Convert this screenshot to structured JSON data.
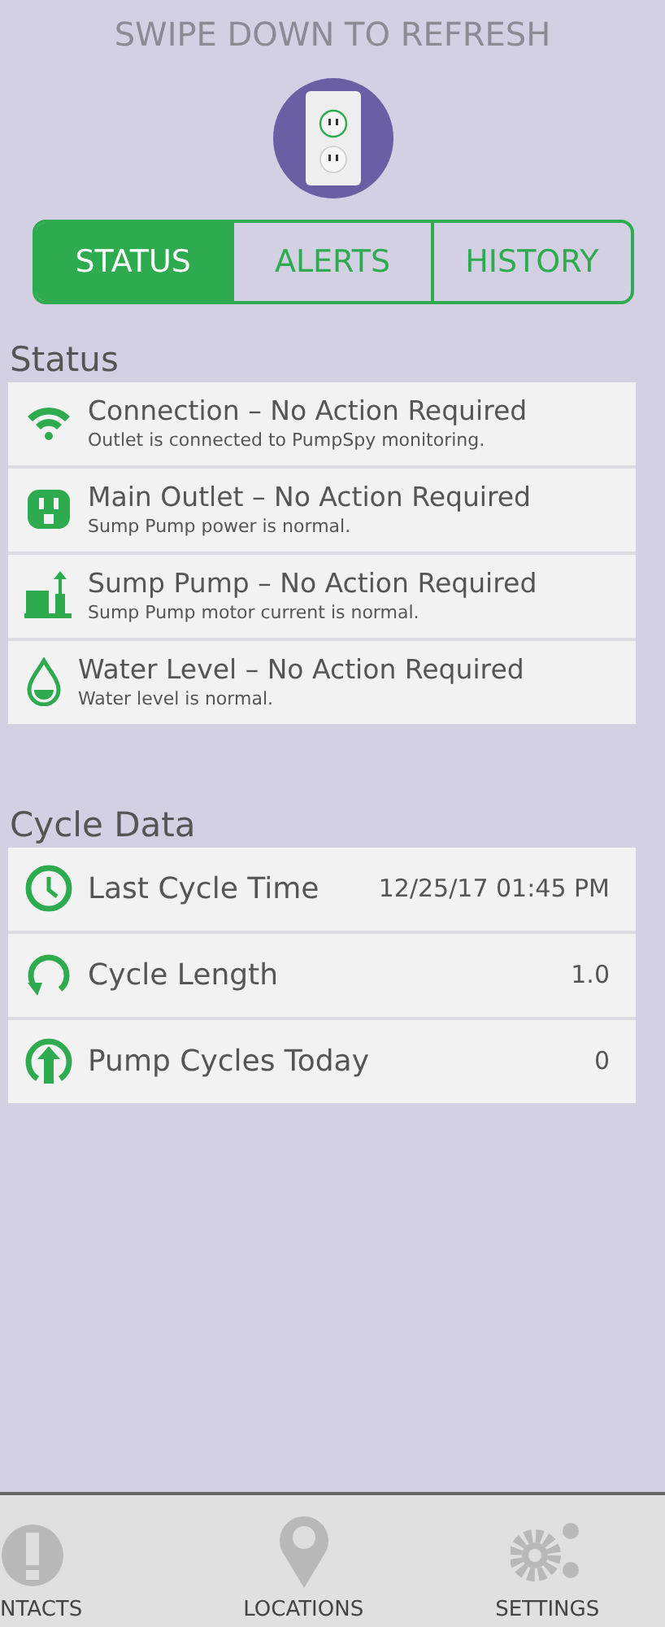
{
  "header": {
    "hint": "SWIPE DOWN TO REFRESH"
  },
  "tabs": [
    {
      "label": "STATUS",
      "selected": true
    },
    {
      "label": "ALERTS",
      "selected": false
    },
    {
      "label": "HISTORY",
      "selected": false
    }
  ],
  "status": {
    "heading": "Status",
    "items": [
      {
        "kind": "wifi",
        "title": "Connection – No Action Required",
        "detail": "Outlet is connected to PumpSpy monitoring."
      },
      {
        "kind": "outlet",
        "title": "Main Outlet – No Action Required",
        "detail": "Sump Pump power is normal."
      },
      {
        "kind": "pump",
        "title": "Sump Pump – No Action Required",
        "detail": "Sump Pump motor current is normal."
      },
      {
        "kind": "water",
        "title": "Water Level – No Action Required",
        "detail": "Water level is normal."
      }
    ]
  },
  "cycle_data": {
    "heading": "Cycle Data",
    "rows": [
      {
        "kind": "clock",
        "label": "Last Cycle Time",
        "value": "12/25/17 01:45 PM"
      },
      {
        "kind": "cycle",
        "label": "Cycle Length",
        "value": "1.0"
      },
      {
        "kind": "up",
        "label": "Pump Cycles Today",
        "value": "0"
      }
    ]
  },
  "nav": [
    {
      "kind": "alert",
      "label": "NTACTS"
    },
    {
      "kind": "pin",
      "label": "LOCATIONS"
    },
    {
      "kind": "gears",
      "label": "SETTINGS"
    }
  ]
}
